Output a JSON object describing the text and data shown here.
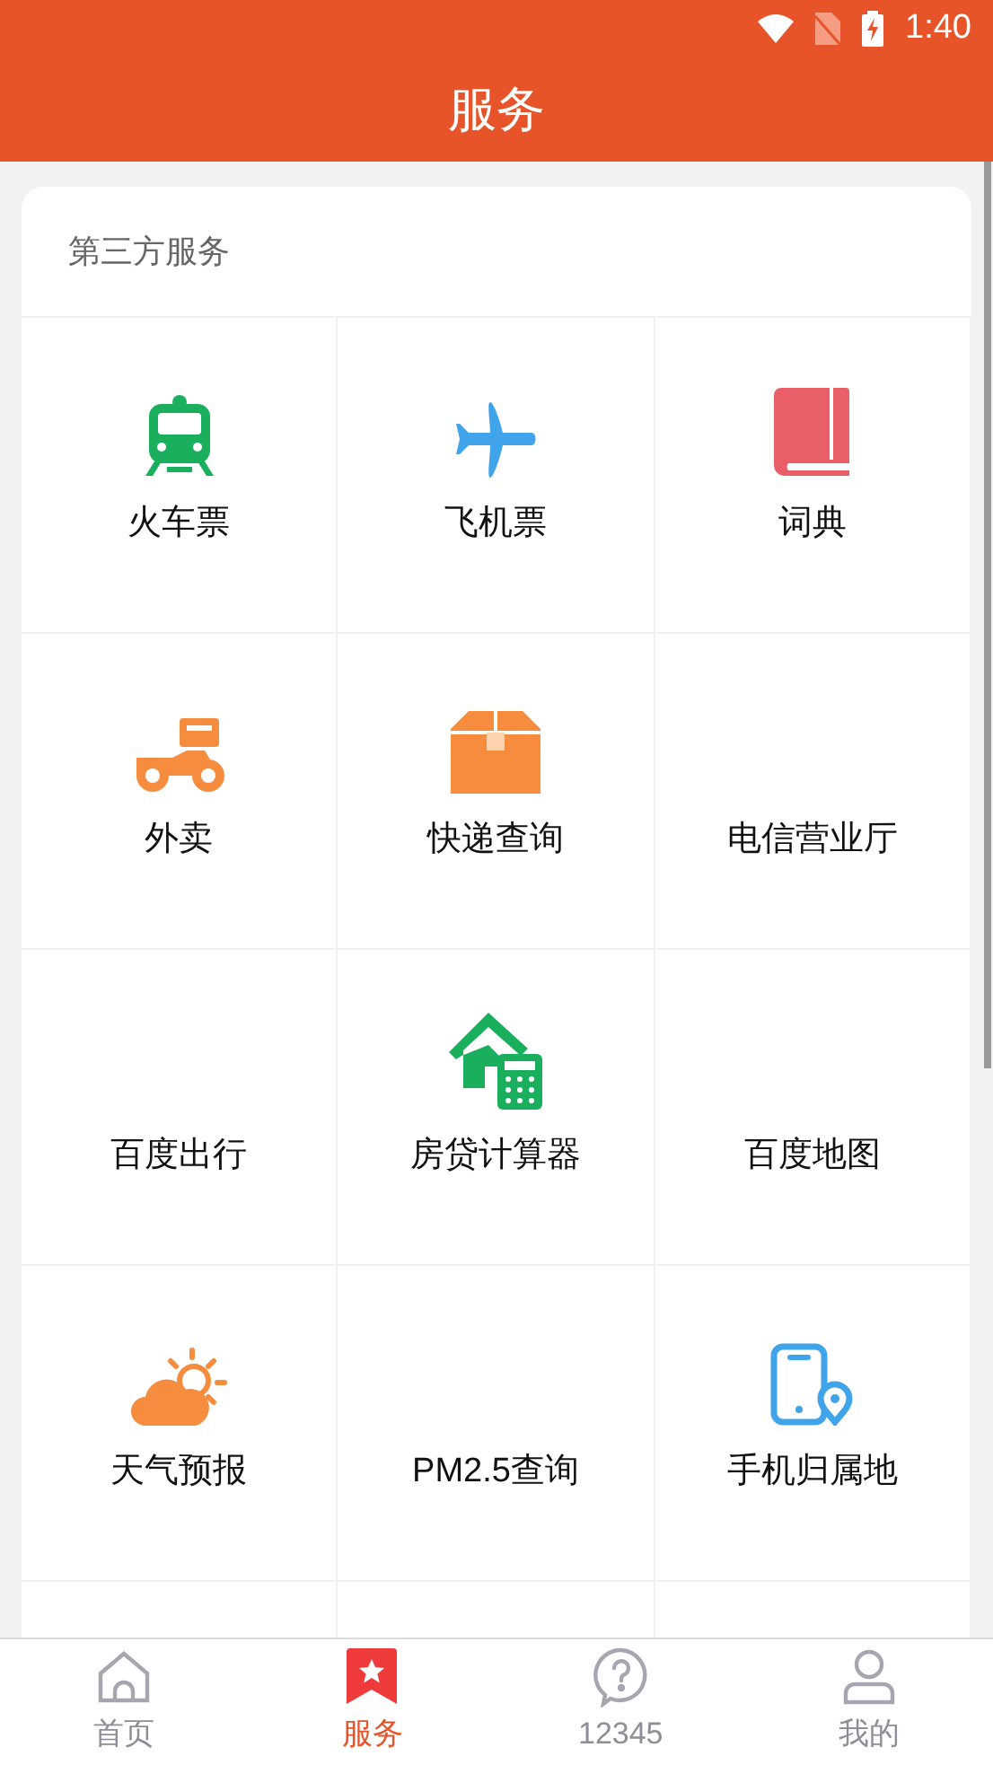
{
  "status_bar": {
    "time": "1:40"
  },
  "header": {
    "title": "服务"
  },
  "section": {
    "title": "第三方服务",
    "items": [
      {
        "label": "火车票",
        "kind": "iconed"
      },
      {
        "label": "飞机票",
        "kind": "iconed"
      },
      {
        "label": "词典",
        "kind": "iconed"
      },
      {
        "label": "外卖",
        "kind": "iconed"
      },
      {
        "label": "快递查询",
        "kind": "iconed"
      },
      {
        "label": "电信营业厅",
        "kind": "plain"
      },
      {
        "label": "百度出行",
        "kind": "plain"
      },
      {
        "label": "房贷计算器",
        "kind": "iconed"
      },
      {
        "label": "百度地图",
        "kind": "plain"
      },
      {
        "label": "天气预报",
        "kind": "iconed"
      },
      {
        "label": "PM2.5查询",
        "kind": "plain"
      },
      {
        "label": "手机归属地",
        "kind": "iconed"
      }
    ]
  },
  "tab_bar": [
    {
      "label": "首页",
      "selected": false
    },
    {
      "label": "服务",
      "selected": true
    },
    {
      "label": "12345",
      "selected": false
    },
    {
      "label": "我的",
      "selected": false
    }
  ]
}
